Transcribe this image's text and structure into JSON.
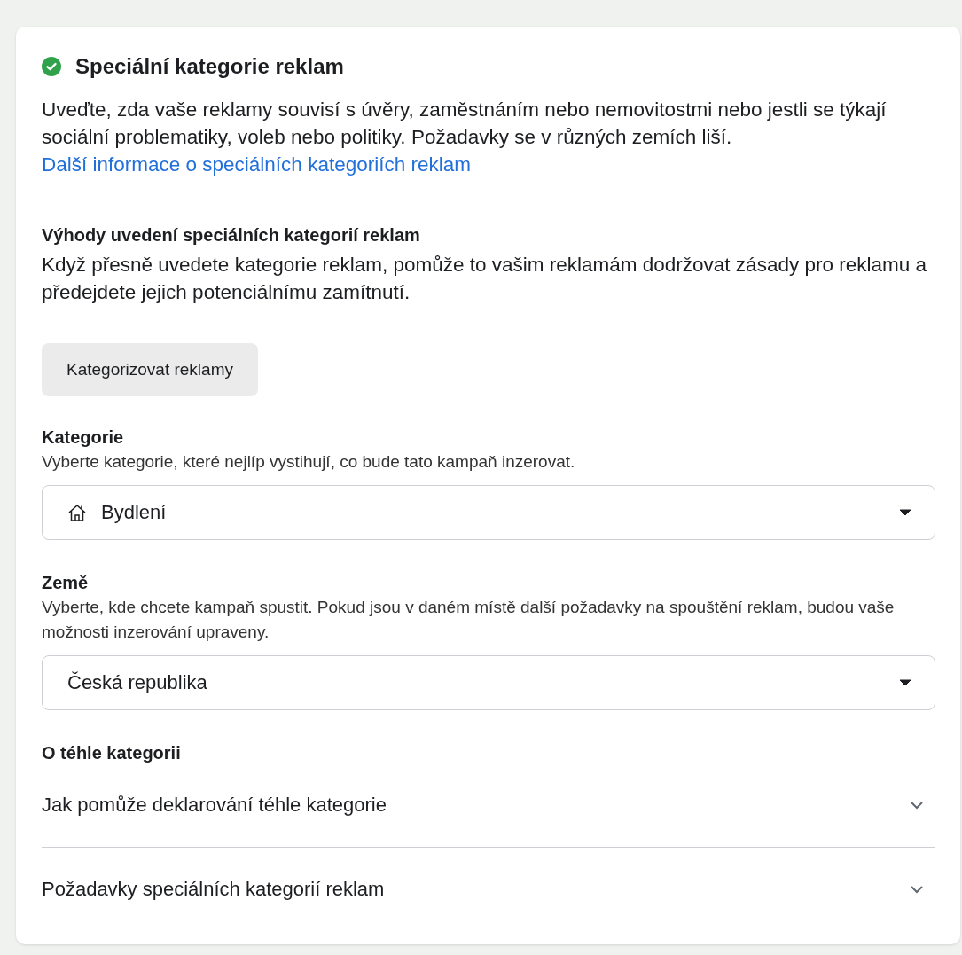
{
  "section": {
    "title": "Speciální kategorie reklam",
    "intro": "Uveďte, zda vaše reklamy souvisí s úvěry, zaměstnáním nebo nemovitostmi nebo jestli se týkají sociální problematiky, voleb nebo politiky. Požadavky se v různých zemích liší.",
    "intro_link": "Další informace o speciálních kategoriích reklam"
  },
  "benefits": {
    "heading": "Výhody uvedení speciálních kategorií reklam",
    "text": "Když přesně uvedete kategorie reklam, pomůže to vašim reklamám dodržovat zásady pro reklamu a předejdete jejich potenciálnímu zamítnutí."
  },
  "button": "Kategorizovat reklamy",
  "fields": [
    {
      "label": "Kategorie",
      "hint": "Vyberte kategorie, které nejlíp vystihují, co bude tato kampaň inzerovat.",
      "value": "Bydlení"
    },
    {
      "label": "Země",
      "hint": "Vyberte, kde chcete kampaň spustit. Pokud jsou v daném místě další požadavky na spouštění reklam, budou vaše možnosti inzerování upraveny.",
      "value": "Česká republika"
    }
  ],
  "about": {
    "heading": "O téhle kategorii",
    "items": [
      {
        "label": "Jak pomůže deklarování téhle kategorie",
        "expanded": false
      },
      {
        "label": "Požadavky speciálních kategorií reklam",
        "expanded": false
      }
    ]
  }
}
